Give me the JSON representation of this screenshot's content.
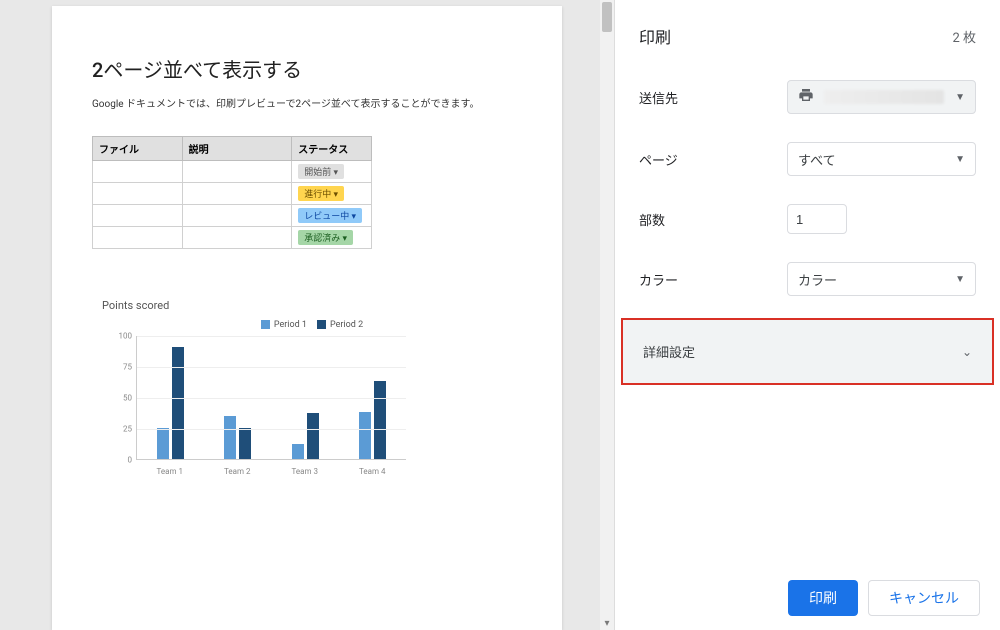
{
  "document": {
    "title": "2ページ並べて表示する",
    "description": "Google ドキュメントでは、印刷プレビューで2ページ並べて表示することができます。",
    "table": {
      "headers": [
        "ファイル",
        "説明",
        "ステータス"
      ],
      "status_badges": [
        {
          "label": "開始前",
          "bg": "#e0e0e0",
          "fg": "#555"
        },
        {
          "label": "進行中",
          "bg": "#ffd54f",
          "fg": "#6b4e00"
        },
        {
          "label": "レビュー中",
          "bg": "#90caf9",
          "fg": "#0d47a1"
        },
        {
          "label": "承認済み",
          "bg": "#a5d6a7",
          "fg": "#1b5e20"
        }
      ]
    }
  },
  "chart_data": {
    "type": "bar",
    "title": "Points scored",
    "categories": [
      "Team 1",
      "Team 2",
      "Team 3",
      "Team 4"
    ],
    "series": [
      {
        "name": "Period 1",
        "color": "#5b9bd5",
        "values": [
          25,
          35,
          12,
          38
        ]
      },
      {
        "name": "Period 2",
        "color": "#1f4e79",
        "values": [
          90,
          25,
          37,
          63
        ]
      }
    ],
    "ylim": [
      0,
      100
    ],
    "yticks": [
      0,
      25,
      50,
      75,
      100
    ],
    "xlabel": "",
    "ylabel": ""
  },
  "print": {
    "header": "印刷",
    "sheets_value": "2",
    "sheets_unit": "枚",
    "destination_label": "送信先",
    "pages_label": "ページ",
    "pages_value": "すべて",
    "copies_label": "部数",
    "copies_value": "1",
    "color_label": "カラー",
    "color_value": "カラー",
    "advanced_label": "詳細設定",
    "print_button": "印刷",
    "cancel_button": "キャンセル"
  }
}
